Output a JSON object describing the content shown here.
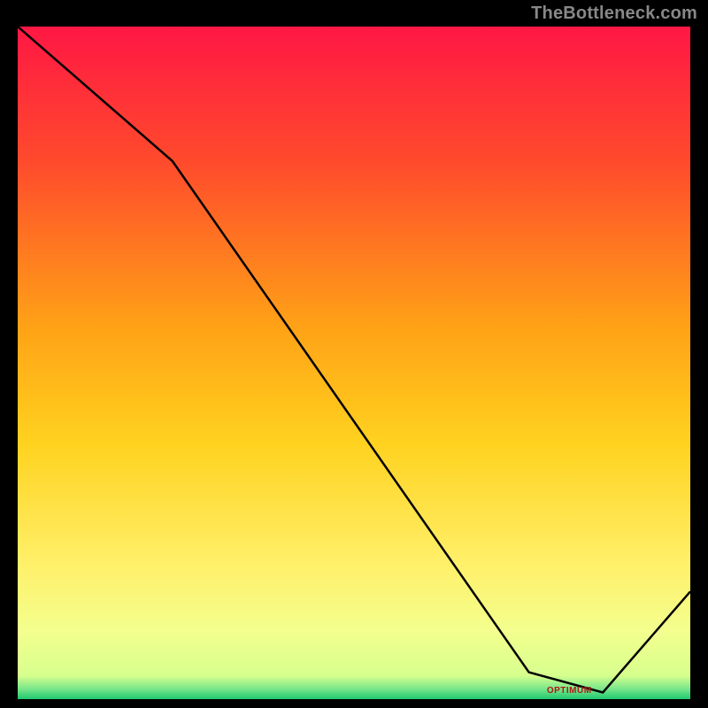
{
  "watermark": "TheBottleneck.com",
  "bottom_label": "OPTIMUM",
  "label_position_pct": 82,
  "colors": {
    "top": "#ff1744",
    "mid_upper": "#ff4a2c",
    "mid": "#ffa316",
    "mid_lower": "#ffd21f",
    "lower": "#fff06a",
    "near_bottom": "#f3ff8e",
    "bottom": "#33d17a",
    "line": "#000000",
    "frame": "#000000"
  },
  "chart_data": {
    "type": "line",
    "title": "",
    "xlabel": "",
    "ylabel": "",
    "xlim": [
      0,
      100
    ],
    "ylim": [
      0,
      100
    ],
    "x": [
      0,
      23,
      76,
      87,
      100
    ],
    "values": [
      100,
      80,
      4,
      1,
      16
    ],
    "gradient_stops": [
      {
        "offset": 0.0,
        "color": "#ff1744"
      },
      {
        "offset": 0.2,
        "color": "#ff4a2c"
      },
      {
        "offset": 0.45,
        "color": "#ffa316"
      },
      {
        "offset": 0.62,
        "color": "#ffd21f"
      },
      {
        "offset": 0.8,
        "color": "#fff06a"
      },
      {
        "offset": 0.9,
        "color": "#f3ff8e"
      },
      {
        "offset": 0.965,
        "color": "#d7ff8e"
      },
      {
        "offset": 0.985,
        "color": "#77e68a"
      },
      {
        "offset": 1.0,
        "color": "#1fc96f"
      }
    ]
  }
}
